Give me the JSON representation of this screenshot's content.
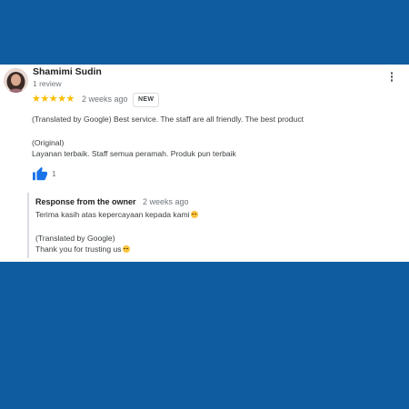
{
  "review": {
    "author": "Shamimi Sudin",
    "author_meta": "1 review",
    "rating": 5,
    "stars": "★★★★★",
    "time": "2 weeks ago",
    "badge": "NEW",
    "translated_text": "(Translated by Google) Best service. The staff are all friendly. The best product",
    "original_label": "(Original)",
    "original_text": "Layanan terbaik. Staff semua peramah. Produk pun terbaik",
    "like_count": "1"
  },
  "owner_response": {
    "title": "Response from the owner",
    "time": "2 weeks ago",
    "original_text": "Terima kasih atas kepercayaan kepada kami",
    "translated_label": "(Translated by Google)",
    "translated_text": "Thank you for trusting us"
  },
  "colors": {
    "background": "#0f5da0",
    "star": "#fbbc04",
    "like": "#1a73e8"
  },
  "icons": {
    "menu": "more-vertical-icon",
    "like": "thumbs-up-icon",
    "emoji": "smiling-face-icon"
  }
}
